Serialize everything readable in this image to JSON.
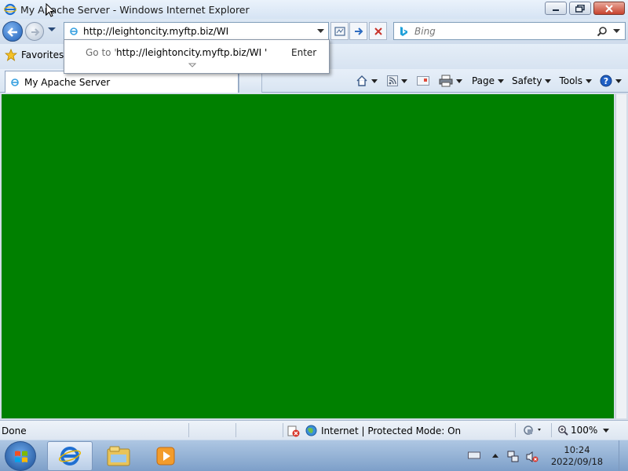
{
  "window": {
    "title": "My Apache Server - Windows Internet Explorer"
  },
  "address_bar": {
    "url": "http://leightoncity.myftp.biz/WI"
  },
  "search": {
    "placeholder": "Bing"
  },
  "autocomplete": {
    "goto_label": "Go to '",
    "url": "http://leightoncity.myftp.biz/WI '",
    "enter_label": "Enter"
  },
  "favorites": {
    "label": "Favorites"
  },
  "tab": {
    "title": "My Apache Server"
  },
  "command_bar": {
    "page": "Page",
    "safety": "Safety",
    "tools": "Tools"
  },
  "page": {
    "background": "#008000",
    "links": [
      "",
      "",
      ""
    ]
  },
  "status_bar": {
    "status": "Done",
    "zone": "Internet | Protected Mode: On",
    "zoom": "100%"
  },
  "taskbar": {
    "time": "10:24",
    "date": "2022/09/18"
  },
  "icons": {
    "app": "ie-icon",
    "back": "back-arrow-icon",
    "forward": "forward-arrow-icon",
    "refresh": "refresh-icon",
    "go": "go-arrow-icon",
    "stop": "stop-icon",
    "search": "magnifier-icon",
    "favorites": "star-icon",
    "home": "home-icon",
    "feeds": "rss-icon",
    "mail": "mail-icon",
    "print": "printer-icon",
    "help": "help-icon"
  }
}
